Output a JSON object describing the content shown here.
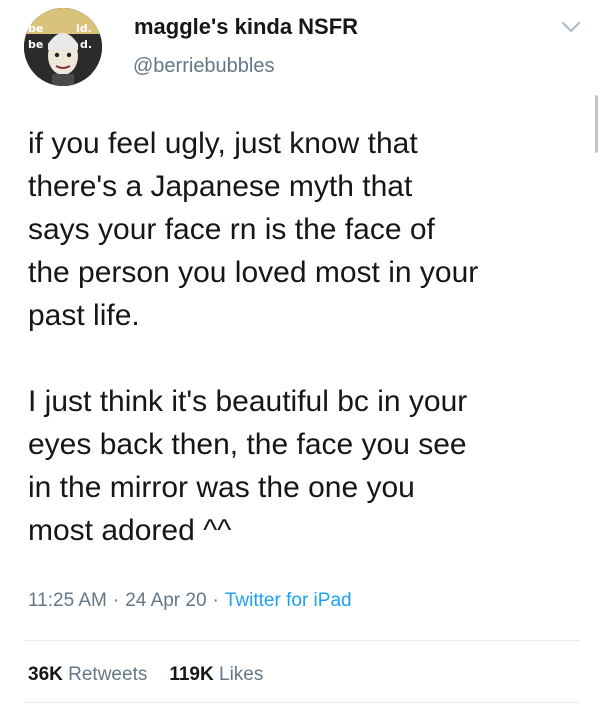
{
  "tweet": {
    "display_name": "maggle's kinda NSFR",
    "handle": "@berriebubbles",
    "paragraphs": [
      "if you feel ugly, just know that\nthere's a Japanese myth that\nsays your face rn is the face of\nthe person you loved most in your\npast life.",
      "I just think it's beautiful bc in your\neyes back then, the face you see\nin the mirror was the one you\nmost adored ^^"
    ],
    "time": "11:25 AM",
    "date": "24 Apr 20",
    "separator": "·",
    "source": "Twitter for iPad",
    "retweets_count": "36K",
    "retweets_label": "Retweets",
    "likes_count": "119K",
    "likes_label": "Likes",
    "avatar_text_1": "be",
    "avatar_text_2": "id.",
    "avatar_text_3": "be",
    "avatar_text_4": "d."
  },
  "icons": {
    "menu": "chevron-down-icon"
  },
  "colors": {
    "text": "#14171a",
    "secondary": "#657786",
    "link": "#1da1f2",
    "divider": "#e6ecf0"
  }
}
